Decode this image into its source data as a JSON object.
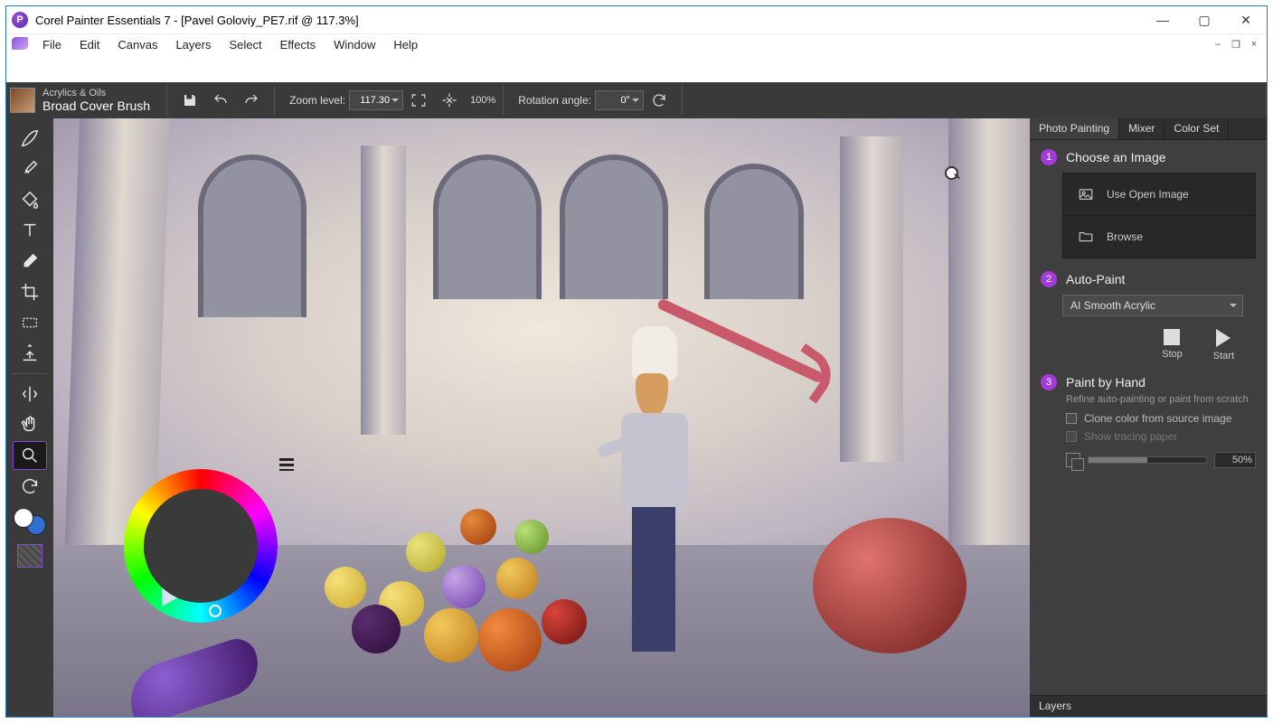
{
  "window": {
    "title": "Corel Painter Essentials 7 - [Pavel Goloviy_PE7.rif @ 117.3%]"
  },
  "menu": [
    "File",
    "Edit",
    "Canvas",
    "Layers",
    "Select",
    "Effects",
    "Window",
    "Help"
  ],
  "brush": {
    "category": "Acrylics & Oils",
    "name": "Broad Cover Brush"
  },
  "toolbar": {
    "zoom_label": "Zoom level:",
    "zoom_value": "117.30",
    "zoom_100": "100%",
    "rotation_label": "Rotation angle:",
    "rotation_value": "0°"
  },
  "right": {
    "tabs": [
      "Photo Painting",
      "Mixer",
      "Color Set"
    ],
    "active_tab": 0,
    "step1": {
      "num": "1",
      "title": "Choose an Image",
      "use_open": "Use Open Image",
      "browse": "Browse"
    },
    "step2": {
      "num": "2",
      "title": "Auto-Paint",
      "preset": "AI Smooth Acrylic",
      "stop": "Stop",
      "start": "Start"
    },
    "step3": {
      "num": "3",
      "title": "Paint by Hand",
      "sub": "Refine auto-painting or paint from scratch",
      "clone": "Clone color from source image",
      "tracing": "Show tracing paper",
      "opacity": "50%"
    },
    "layers": "Layers"
  },
  "tools": [
    "brush",
    "dropper",
    "paint-bucket",
    "text",
    "eraser",
    "crop",
    "rect-select",
    "clone",
    "mirror",
    "hand",
    "magnifier",
    "rotate-view"
  ],
  "active_tool": "magnifier"
}
